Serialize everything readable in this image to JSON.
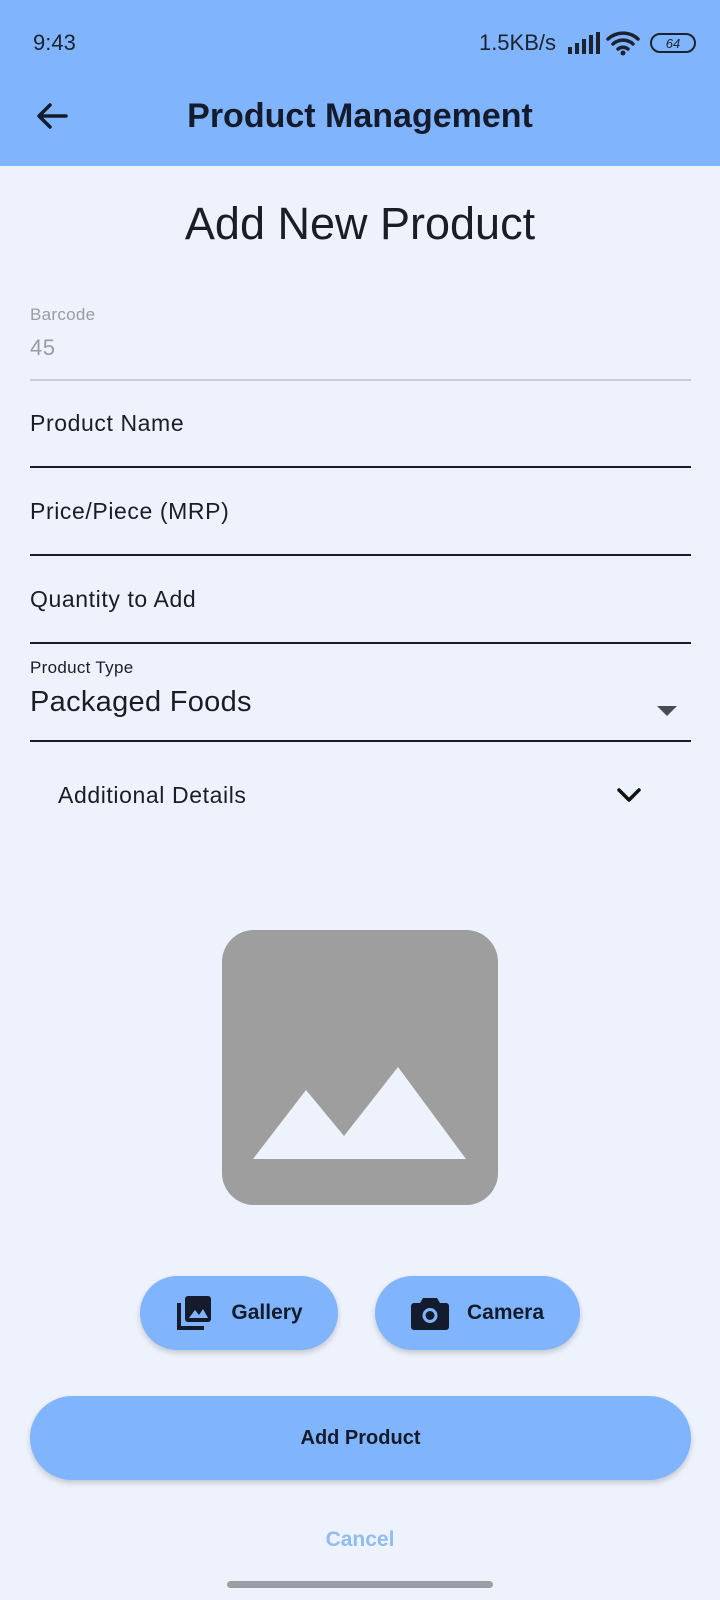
{
  "status_bar": {
    "time": "9:43",
    "net_speed": "1.5KB/s",
    "battery": "64"
  },
  "header": {
    "title": "Product Management",
    "back_icon": "arrow-left-icon"
  },
  "form": {
    "heading": "Add New Product",
    "barcode": {
      "label": "Barcode",
      "value": "45"
    },
    "product_name": {
      "label": "Product Name"
    },
    "price": {
      "label": "Price/Piece (MRP)"
    },
    "quantity": {
      "label": "Quantity to Add"
    },
    "product_type": {
      "label": "Product Type",
      "value": "Packaged Foods"
    },
    "additional_details": {
      "label": "Additional Details"
    }
  },
  "image_picker": {
    "gallery_label": "Gallery",
    "camera_label": "Camera"
  },
  "actions": {
    "add_label": "Add Product",
    "cancel_label": "Cancel"
  },
  "colors": {
    "primary": "#80b5fd",
    "background": "#eef2fd",
    "cancel_text": "#8fbdf3",
    "image_placeholder": "#9e9e9e"
  }
}
